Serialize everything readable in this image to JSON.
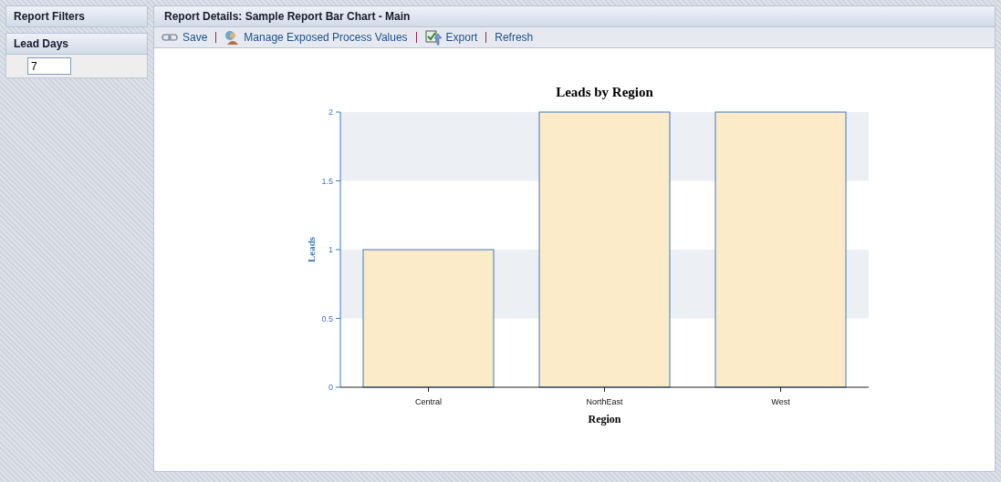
{
  "sidebar": {
    "title": "Report Filters",
    "filters": [
      {
        "label": "Lead Days",
        "value": "7"
      }
    ]
  },
  "panel": {
    "title": "Report Details: Sample Report Bar Chart - Main",
    "toolbar": [
      {
        "label": "Save",
        "kind": "link"
      },
      {
        "label": "Manage Exposed Process Values",
        "kind": "user"
      },
      {
        "label": "Export",
        "kind": "export"
      },
      {
        "label": "Refresh",
        "kind": "plain"
      }
    ],
    "chart_data": {
      "type": "bar",
      "title": "Leads by Region",
      "xlabel": "Region",
      "ylabel": "Leads",
      "categories": [
        "Central",
        "NorthEast",
        "West"
      ],
      "series": [
        {
          "color": "#fcebc8",
          "values": [
            1,
            2,
            2
          ]
        }
      ],
      "ylim": [
        0,
        2
      ],
      "yticks": [
        {
          "value": 0,
          "label": "0"
        },
        {
          "value": 0.5,
          "label": "0.5"
        },
        {
          "value": 1,
          "label": "1"
        },
        {
          "value": 1.5,
          "label": "1.5"
        },
        {
          "value": 2,
          "label": "2"
        }
      ]
    }
  }
}
